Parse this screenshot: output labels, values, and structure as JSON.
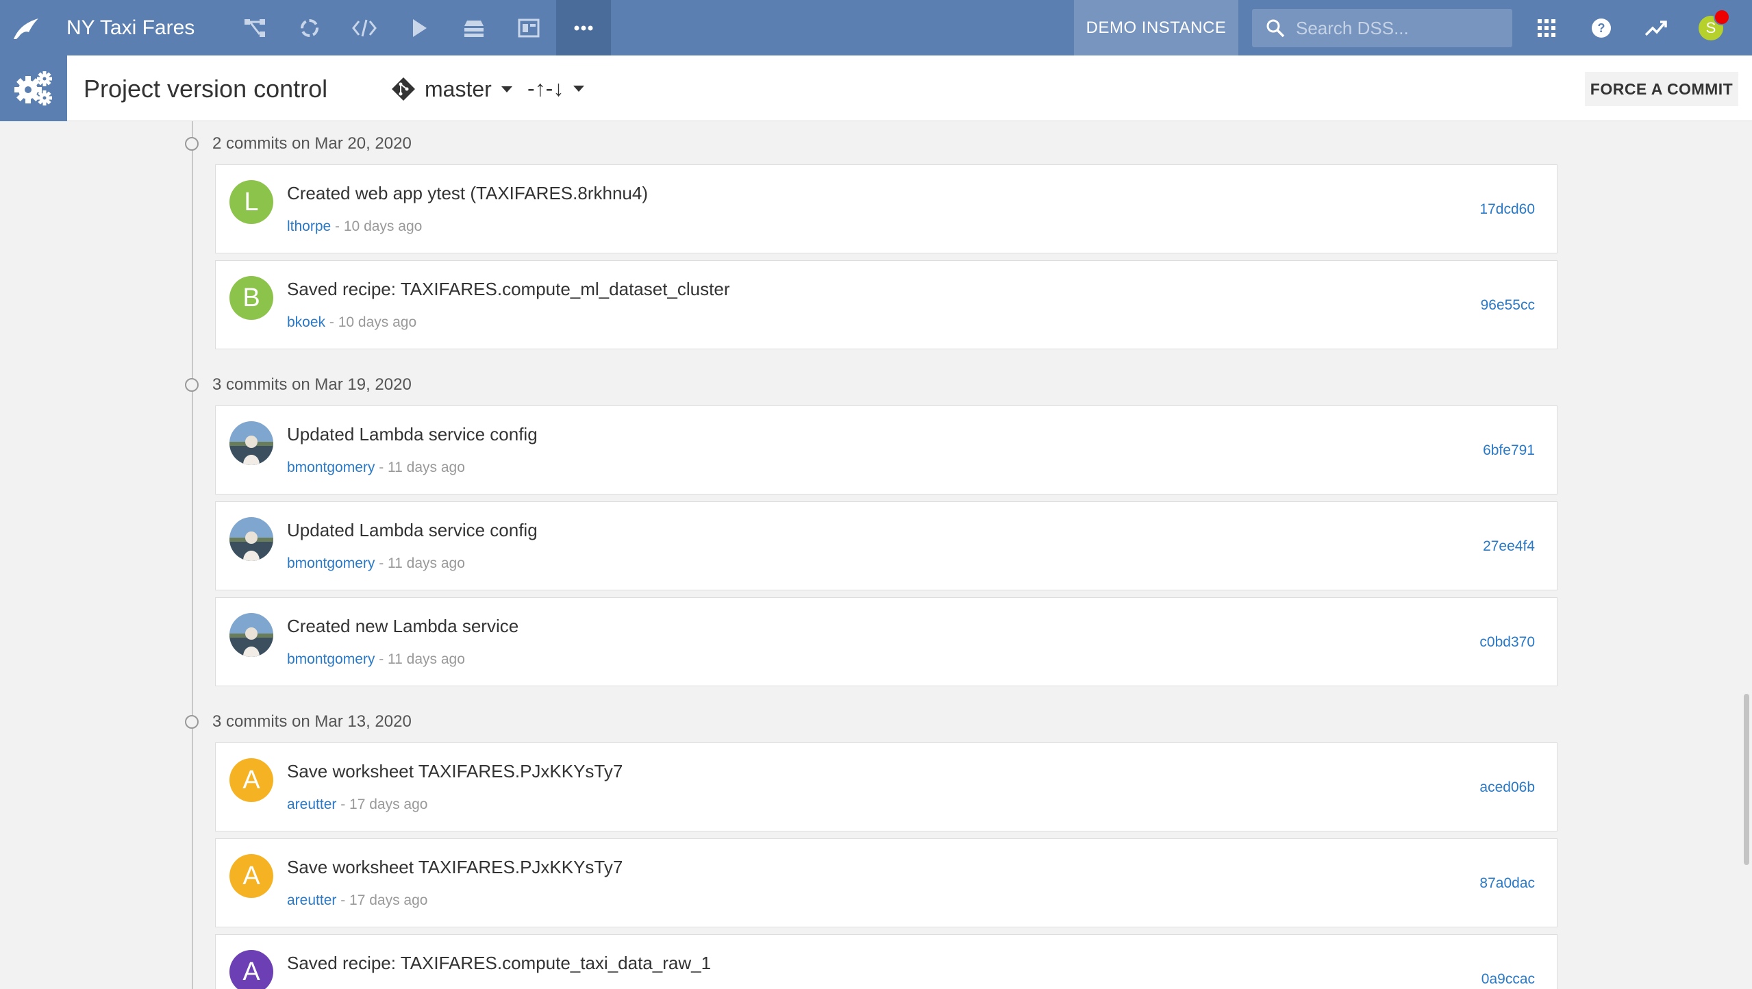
{
  "topnav": {
    "project_name": "NY Taxi Fares",
    "demo_instance": "DEMO INSTANCE",
    "search_placeholder": "Search DSS...",
    "user_initial": "S",
    "colors": {
      "bar": "#5a7fb0",
      "active": "#4a6c9b"
    }
  },
  "subheader": {
    "title": "Project version control",
    "branch": "master",
    "sync_symbol": "-↑-↓",
    "force_commit": "FORCE A COMMIT"
  },
  "groups": [
    {
      "label": "2 commits on Mar 20, 2020",
      "commits": [
        {
          "initial": "L",
          "color": "#8cc34a",
          "message": "Created web app ytest (TAXIFARES.8rkhnu4)",
          "author": "lthorpe",
          "ago": " - 10 days ago",
          "hash": "17dcd60"
        },
        {
          "initial": "B",
          "color": "#8cc34a",
          "message": "Saved recipe: TAXIFARES.compute_ml_dataset_cluster",
          "author": "bkoek",
          "ago": " - 10 days ago",
          "hash": "96e55cc"
        }
      ]
    },
    {
      "label": "3 commits on Mar 19, 2020",
      "commits": [
        {
          "initial": "",
          "color": "photo",
          "message": "Updated Lambda service config",
          "author": "bmontgomery",
          "ago": " - 11 days ago",
          "hash": "6bfe791"
        },
        {
          "initial": "",
          "color": "photo",
          "message": "Updated Lambda service config",
          "author": "bmontgomery",
          "ago": " - 11 days ago",
          "hash": "27ee4f4"
        },
        {
          "initial": "",
          "color": "photo",
          "message": "Created new Lambda service",
          "author": "bmontgomery",
          "ago": " - 11 days ago",
          "hash": "c0bd370"
        }
      ]
    },
    {
      "label": "3 commits on Mar 13, 2020",
      "commits": [
        {
          "initial": "A",
          "color": "#f5b324",
          "message": "Save worksheet TAXIFARES.PJxKKYsTy7",
          "author": "areutter",
          "ago": " - 17 days ago",
          "hash": "aced06b"
        },
        {
          "initial": "A",
          "color": "#f5b324",
          "message": "Save worksheet TAXIFARES.PJxKKYsTy7",
          "author": "areutter",
          "ago": " - 17 days ago",
          "hash": "87a0dac"
        },
        {
          "initial": "A",
          "color": "#6c3fb5",
          "message": "Saved recipe: TAXIFARES.compute_taxi_data_raw_1",
          "author": "",
          "ago": "",
          "hash": "0a9ccac"
        }
      ]
    }
  ]
}
